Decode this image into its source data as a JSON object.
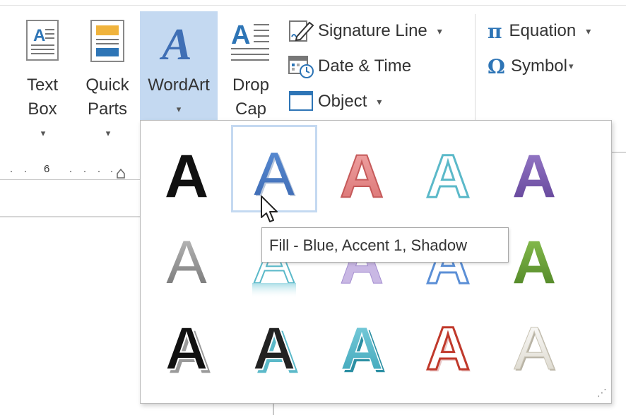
{
  "ribbon": {
    "text_box": {
      "line1": "Text",
      "line2": "Box",
      "icon": "text-box-icon"
    },
    "quick_parts": {
      "line1": "Quick",
      "line2": "Parts",
      "icon": "quick-parts-icon"
    },
    "wordart": {
      "line1": "WordArt",
      "icon": "wordart-icon",
      "state": "active"
    },
    "drop_cap": {
      "line1": "Drop",
      "line2": "Cap",
      "icon": "drop-cap-icon"
    },
    "signature_line": {
      "label": "Signature Line",
      "icon": "signature-line-icon"
    },
    "date_time": {
      "label": "Date & Time",
      "icon": "date-time-icon"
    },
    "object": {
      "label": "Object",
      "icon": "object-icon"
    },
    "equation": {
      "label": "Equation",
      "icon": "pi-icon"
    },
    "symbol": {
      "label": "Symbol",
      "icon": "omega-icon"
    },
    "dropdown_glyph": "▾"
  },
  "ruler": {
    "number": "6"
  },
  "wordart_gallery": {
    "glyph": "A",
    "selected_index": 1,
    "styles": [
      {
        "row": 0,
        "col": 0,
        "style": "fill-black"
      },
      {
        "row": 0,
        "col": 1,
        "style": "fill-blue-accent1-shadow"
      },
      {
        "row": 0,
        "col": 2,
        "style": "fill-red-outline"
      },
      {
        "row": 0,
        "col": 3,
        "style": "outline-teal"
      },
      {
        "row": 0,
        "col": 4,
        "style": "fill-purple-bevel"
      },
      {
        "row": 1,
        "col": 0,
        "style": "fill-gray-gradient"
      },
      {
        "row": 1,
        "col": 1,
        "style": "teal-reflection"
      },
      {
        "row": 1,
        "col": 2,
        "style": "purple-light"
      },
      {
        "row": 1,
        "col": 3,
        "style": "blue-outline"
      },
      {
        "row": 1,
        "col": 4,
        "style": "fill-green-bevel"
      },
      {
        "row": 2,
        "col": 0,
        "style": "black-3d-shadow"
      },
      {
        "row": 2,
        "col": 1,
        "style": "black-blue-shadow"
      },
      {
        "row": 2,
        "col": 2,
        "style": "teal-3d"
      },
      {
        "row": 2,
        "col": 3,
        "style": "red-outline-3d"
      },
      {
        "row": 2,
        "col": 4,
        "style": "white-gray-bevel"
      }
    ],
    "colors": {
      "blue": "#4472c4",
      "red": "#e07070",
      "teal": "#5bb9c9",
      "purple": "#7a5ea8",
      "green": "#5d9630",
      "gray": "#8a8a8a",
      "selection": "#c4d9f1"
    }
  },
  "tooltip": {
    "text": "Fill - Blue, Accent 1, Shadow"
  }
}
